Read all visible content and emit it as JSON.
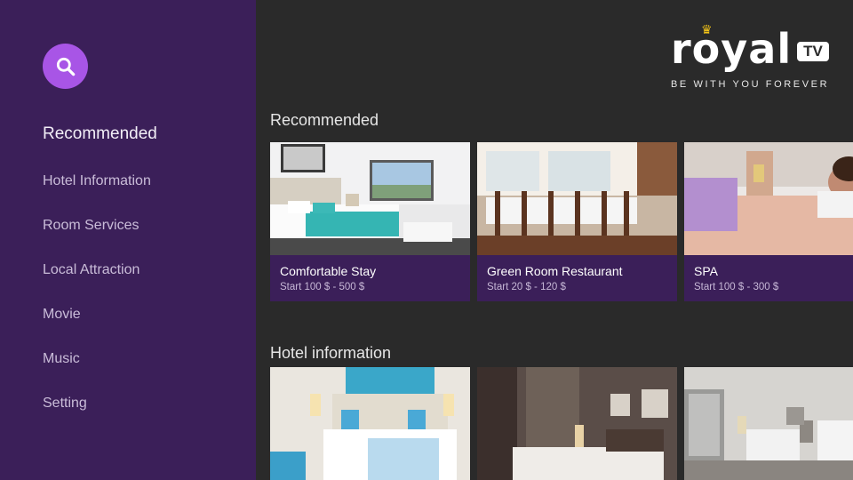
{
  "app": {
    "brand": "royal",
    "brand_suffix": "TV",
    "tagline": "BE WITH YOU FOREVER"
  },
  "sidebar": {
    "search_icon": "search-icon",
    "items": [
      {
        "label": "Recommended",
        "active": true
      },
      {
        "label": "Hotel Information"
      },
      {
        "label": "Room Services"
      },
      {
        "label": "Local Attraction"
      },
      {
        "label": "Movie"
      },
      {
        "label": "Music"
      },
      {
        "label": "Setting"
      }
    ]
  },
  "sections": [
    {
      "title": "Recommended",
      "cards": [
        {
          "name": "Comfortable Stay",
          "price": "Start 100 $ - 500 $"
        },
        {
          "name": "Green Room Restaurant",
          "price": "Start 20 $ - 120 $"
        },
        {
          "name": "SPA",
          "price": "Start 100 $ - 300 $"
        }
      ]
    },
    {
      "title": "Hotel information",
      "cards": [
        {},
        {},
        {}
      ]
    }
  ],
  "colors": {
    "sidebar_bg": "#3b1f59",
    "accent": "#a855e6",
    "card_bg": "#3b1f59",
    "main_bg": "#2a2a2a"
  }
}
